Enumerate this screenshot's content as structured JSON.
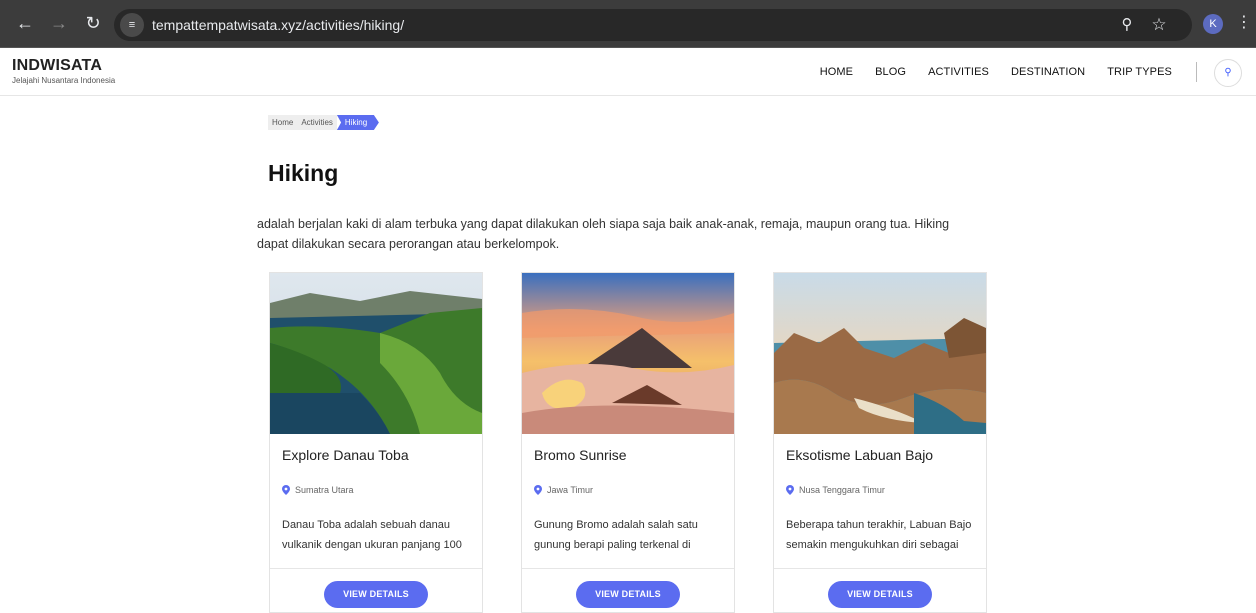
{
  "browser": {
    "url": "tempattempatwisata.xyz/activities/hiking/",
    "profile_initial": "K",
    "icons": [
      "back-arrow-icon",
      "forward-arrow-icon",
      "reload-icon",
      "site-info-icon",
      "zoom-icon",
      "star-icon",
      "menu-dots-icon"
    ]
  },
  "header": {
    "brand": "INDWISATA",
    "tagline": "Jelajahi Nusantara Indonesia",
    "nav": [
      "HOME",
      "BLOG",
      "ACTIVITIES",
      "DESTINATION",
      "TRIP TYPES"
    ],
    "search_icon": "search-icon"
  },
  "breadcrumb": [
    "Home",
    "Activities",
    "Hiking"
  ],
  "page": {
    "title": "Hiking",
    "description": "adalah berjalan kaki di alam terbuka yang dapat dilakukan oleh siapa saja baik anak-anak, remaja, maupun orang tua. Hiking dapat dilakukan secara perorangan atau berkelompok."
  },
  "cards": [
    {
      "title": "Explore Danau Toba",
      "location": "Sumatra Utara",
      "excerpt": "Danau Toba adalah sebuah danau vulkanik dengan ukuran panjang 100",
      "button": "VIEW DETAILS"
    },
    {
      "title": "Bromo Sunrise",
      "location": "Jawa Timur",
      "excerpt": "Gunung Bromo adalah salah satu gunung berapi paling terkenal di",
      "button": "VIEW DETAILS"
    },
    {
      "title": "Eksotisme Labuan Bajo",
      "location": "Nusa Tenggara Timur",
      "excerpt": "Beberapa tahun terakhir, Labuan Bajo semakin mengukuhkan diri sebagai",
      "button": "VIEW DETAILS"
    }
  ],
  "colors": {
    "accent": "#5b6cf0",
    "browser_bg": "#3c3c3c"
  }
}
